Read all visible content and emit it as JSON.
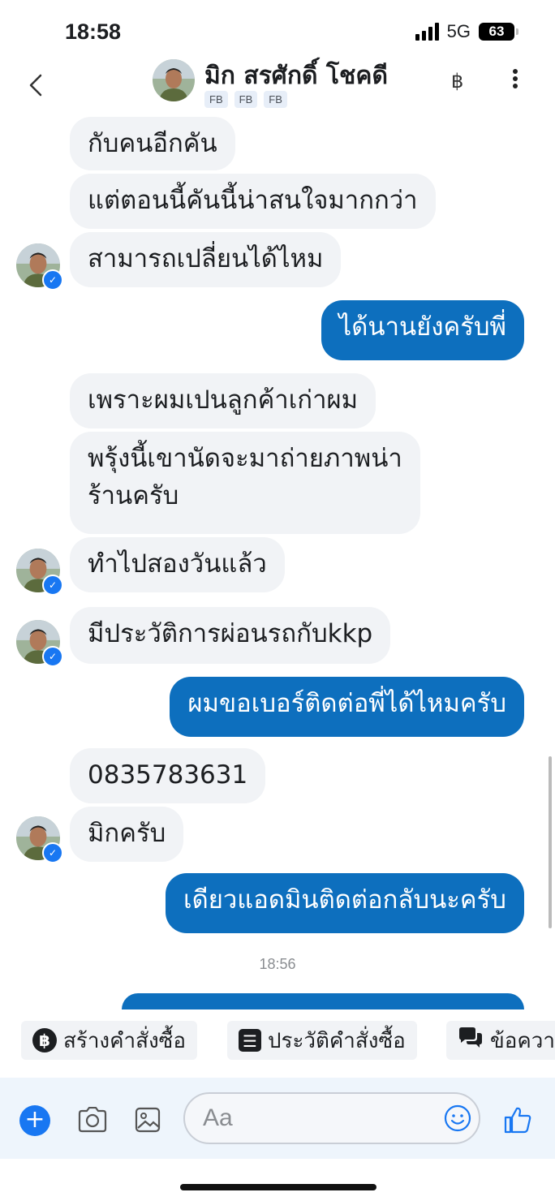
{
  "status_bar": {
    "time": "18:58",
    "network": "5G",
    "battery": "63"
  },
  "header": {
    "contact_name": "มิก สรศักดิ์ โชคดี",
    "tags": [
      "FB",
      "FB",
      "FB"
    ],
    "baht_symbol": "฿",
    "back_icon": "chevron-left",
    "more_icon": "vertical-ellipsis"
  },
  "messages": [
    {
      "sender": "contact",
      "text": "กับคนอีกคัน"
    },
    {
      "sender": "contact",
      "text": "แต่ตอนนี้คันนี้น่าสนใจมากกว่า"
    },
    {
      "sender": "contact",
      "text": "สามารถเปลี่ยนได้ไหม"
    },
    {
      "sender": "me",
      "text": "ได้นานยังครับพี่"
    },
    {
      "sender": "contact",
      "text": "เพราะผมเปนลูกค้าเก่าผม"
    },
    {
      "sender": "contact",
      "line1": "พรุ้งนี้เขานัดจะมาถ่ายภาพน่า",
      "line2": "ร้านครับ"
    },
    {
      "sender": "contact",
      "text": "ทำไปสองวันแล้ว"
    },
    {
      "sender": "contact",
      "text": "มีประวัติการผ่อนรถกับkkp"
    },
    {
      "sender": "me",
      "text": "ผมขอเบอร์ติดต่อพี่ได้ไหมครับ"
    },
    {
      "sender": "contact",
      "text": "0835783631"
    },
    {
      "sender": "contact",
      "text": "มิกครับ"
    },
    {
      "sender": "me",
      "text": "เดียวแอดมินติดต่อกลับนะครับ"
    }
  ],
  "timestamp": "18:56",
  "quick_actions": [
    {
      "label": "สร้างคำสั่งซื้อ",
      "icon": "baht-circle-icon",
      "glyph": "฿"
    },
    {
      "label": "ประวัติคำสั่งซื้อ",
      "icon": "list-icon",
      "glyph": "☰"
    },
    {
      "label": "ข้อควา",
      "icon": "chat-bubbles-icon",
      "glyph": ""
    }
  ],
  "composer": {
    "placeholder": "Aa"
  },
  "colors": {
    "accent": "#0d6fbe",
    "incoming_bubble": "#f1f3f6",
    "plus_button": "#1877f2"
  }
}
